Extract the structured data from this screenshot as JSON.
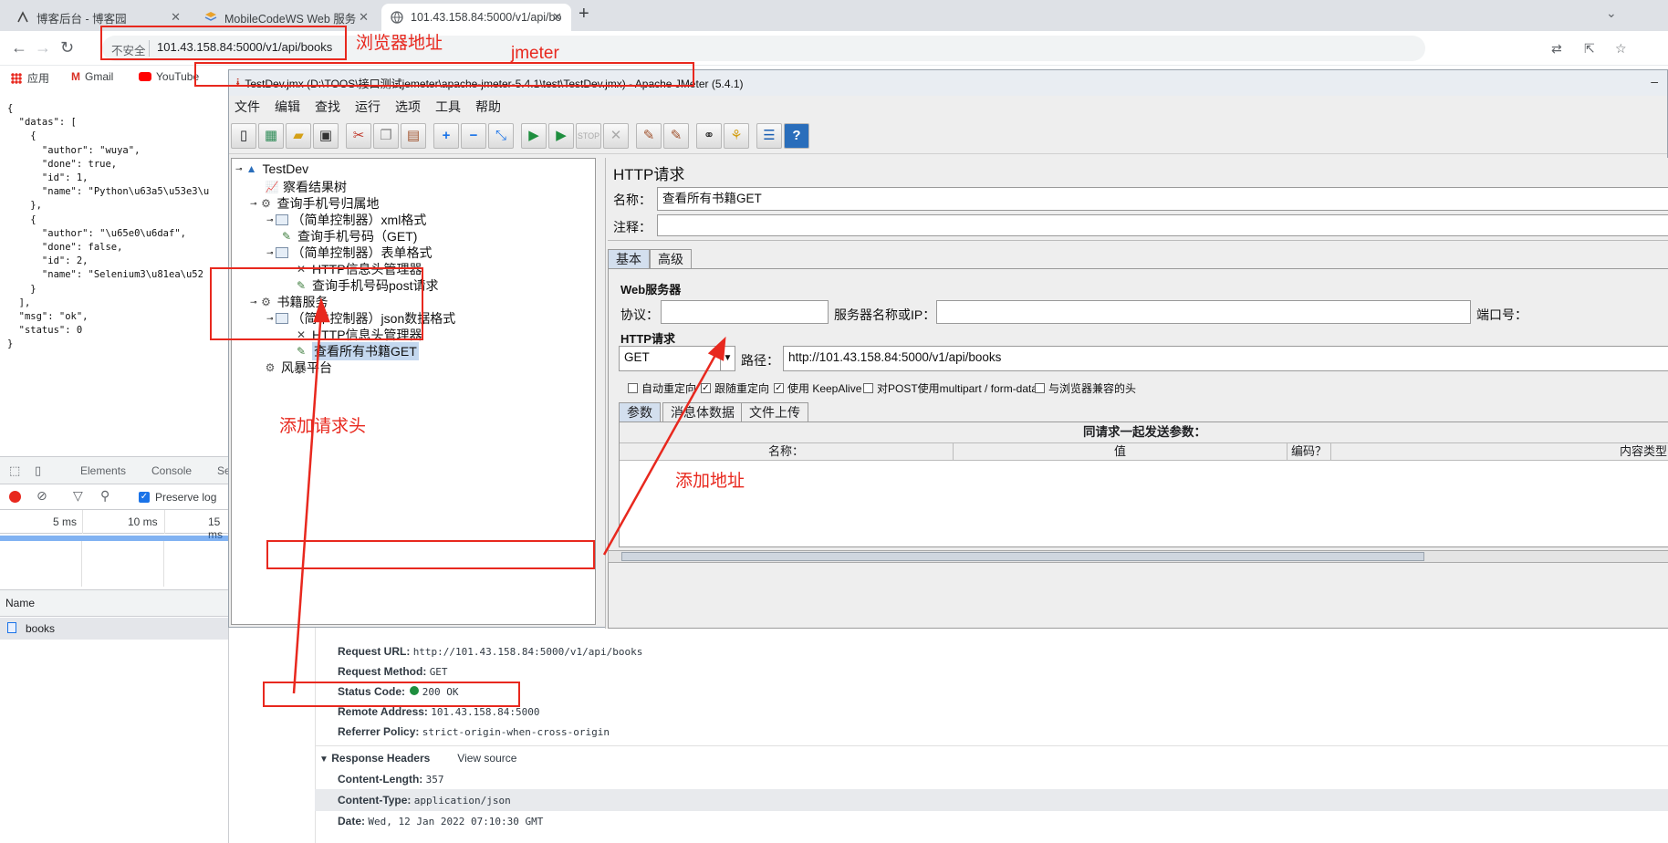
{
  "browser": {
    "tabs": [
      {
        "title": "博客后台 - 博客园",
        "icon": "cnblogs-icon"
      },
      {
        "title": "MobileCodeWS Web 服务",
        "icon": "webservice-icon"
      },
      {
        "title": "101.43.158.84:5000/v1/api/bo",
        "icon": "globe-icon"
      }
    ],
    "new_tab": "+",
    "address": {
      "security": "不安全",
      "url": "101.43.158.84:5000/v1/api/books"
    },
    "bookmarks": [
      {
        "label": "应用",
        "icon": "apps-grid-icon"
      },
      {
        "label": "Gmail",
        "icon": "gmail-icon"
      },
      {
        "label": "YouTube",
        "icon": "youtube-icon"
      }
    ]
  },
  "page_json": "{\n  \"datas\": [\n    {\n      \"author\": \"wuya\",\n      \"done\": true,\n      \"id\": 1,\n      \"name\": \"Python\\u63a5\\u53e3\\u\n    },\n    {\n      \"author\": \"\\u65e0\\u6daf\",\n      \"done\": false,\n      \"id\": 2,\n      \"name\": \"Selenium3\\u81ea\\u52\n    }\n  ],\n  \"msg\": \"ok\",\n  \"status\": 0\n}",
  "devtools": {
    "tabs": [
      "Elements",
      "Console",
      "Se"
    ],
    "preserve_log": "Preserve log",
    "timeline": [
      "5 ms",
      "10 ms",
      "15 ms"
    ],
    "name_header": "Name",
    "request_name": "books",
    "general": [
      {
        "key": "Request URL:",
        "value": "http://101.43.158.84:5000/v1/api/books"
      },
      {
        "key": "Request Method:",
        "value": "GET"
      },
      {
        "key": "Status Code:",
        "value": "200 OK"
      },
      {
        "key": "Remote Address:",
        "value": "101.43.158.84:5000"
      },
      {
        "key": "Referrer Policy:",
        "value": "strict-origin-when-cross-origin"
      }
    ],
    "response_headers_title": "Response Headers",
    "view_source": "View source",
    "response_headers": [
      {
        "key": "Content-Length:",
        "value": "357"
      },
      {
        "key": "Content-Type:",
        "value": "application/json"
      },
      {
        "key": "Date:",
        "value": "Wed, 12 Jan 2022 07:10:30 GMT"
      }
    ]
  },
  "jmeter": {
    "title": "TestDev.jmx (D:\\TOOS\\接口测试jemeter\\apache-jmeter-5.4.1\\test\\TestDev.jmx) - Apache JMeter (5.4.1)",
    "menu": [
      "文件",
      "编辑",
      "查找",
      "运行",
      "选项",
      "工具",
      "帮助"
    ],
    "tree": [
      {
        "label": "TestDev",
        "icon": "testplan-icon"
      },
      {
        "label": "察看结果树",
        "icon": "graph-icon"
      },
      {
        "label": "查询手机号归属地",
        "icon": "threadgroup-gear-icon"
      },
      {
        "label": "（简单控制器）xml格式",
        "icon": "controller-icon"
      },
      {
        "label": "查询手机号码（GET)",
        "icon": "sampler-pen-icon"
      },
      {
        "label": "（简单控制器）表单格式",
        "icon": "controller-icon"
      },
      {
        "label": "HTTP信息头管理器",
        "icon": "header-tools-icon"
      },
      {
        "label": "查询手机号码post请求",
        "icon": "sampler-pen-icon"
      },
      {
        "label": "书籍服务",
        "icon": "threadgroup-gear-icon"
      },
      {
        "label": "（简单控制器）json数据格式",
        "icon": "controller-icon"
      },
      {
        "label": "HTTP信息头管理器",
        "icon": "header-tools-icon"
      },
      {
        "label": "查看所有书籍GET",
        "icon": "sampler-pen-icon"
      },
      {
        "label": "风暴平台",
        "icon": "threadgroup-gear-icon"
      }
    ],
    "panel": {
      "title": "HTTP请求",
      "name_label": "名称：",
      "name_value": "查看所有书籍GET",
      "comment_label": "注释：",
      "tabs": [
        "基本",
        "高级"
      ],
      "web_server": "Web服务器",
      "protocol_label": "协议：",
      "server_label": "服务器名称或IP：",
      "port_label": "端口号：",
      "http_request": "HTTP请求",
      "method": "GET",
      "path_label": "路径：",
      "path_value": "http://101.43.158.84:5000/v1/api/books",
      "checkboxes": [
        {
          "label": "自动重定向",
          "checked": false
        },
        {
          "label": "跟随重定向",
          "checked": true
        },
        {
          "label": "使用 KeepAlive",
          "checked": true
        },
        {
          "label": "对POST使用multipart / form-data",
          "checked": false
        },
        {
          "label": "与浏览器兼容的头",
          "checked": false
        }
      ],
      "param_tabs": [
        "参数",
        "消息体数据",
        "文件上传"
      ],
      "params_caption": "同请求一起发送参数：",
      "columns": [
        "名称：",
        "值",
        "编码？",
        "内容类型"
      ]
    }
  },
  "annotations": {
    "browser_address": "浏览器地址",
    "jmeter": "jmeter",
    "add_header": "添加请求头",
    "add_address": "添加地址"
  },
  "colors": {
    "annotation": "#e8281e",
    "selection": "#c4d8ef"
  }
}
